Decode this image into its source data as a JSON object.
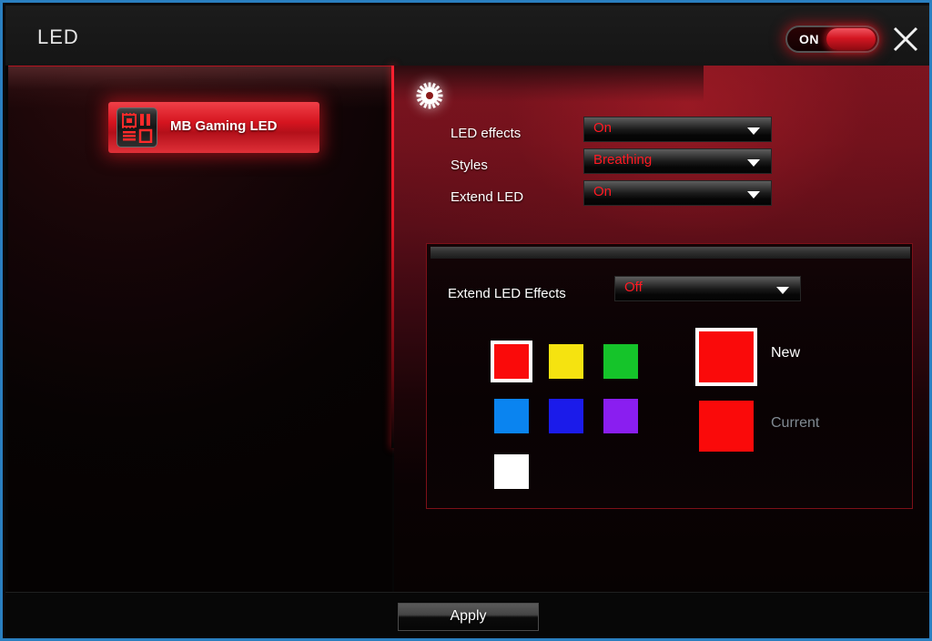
{
  "window": {
    "title": "LED",
    "accent_color": "#d5141f",
    "frame_color": "#2a7fc0",
    "power_toggle": {
      "state_label": "ON",
      "enabled": true
    },
    "close_label": "Close"
  },
  "sidebar": {
    "items": [
      {
        "label": "MB Gaming LED",
        "icon": "motherboard-icon",
        "selected": true
      }
    ]
  },
  "main": {
    "header_icon": "gear-icon",
    "settings": [
      {
        "label": "LED effects",
        "value": "On"
      },
      {
        "label": "Styles",
        "value": "Breathing"
      },
      {
        "label": "Extend LED",
        "value": "On"
      }
    ],
    "extend_section": {
      "label": "Extend LED Effects",
      "value": "Off",
      "swatches": [
        {
          "name": "red",
          "color": "#fa0a0a",
          "selected": true
        },
        {
          "name": "yellow",
          "color": "#f5e310",
          "selected": false
        },
        {
          "name": "green",
          "color": "#15c42a",
          "selected": false
        },
        {
          "name": "light-blue",
          "color": "#0a84f0",
          "selected": false
        },
        {
          "name": "blue",
          "color": "#1b1bea",
          "selected": false
        },
        {
          "name": "purple",
          "color": "#8a1ef0",
          "selected": false
        },
        {
          "name": "white",
          "color": "#ffffff",
          "selected": false
        }
      ],
      "preview": {
        "new": {
          "label": "New",
          "color": "#fa0a0a",
          "text_color": "#ffffff"
        },
        "current": {
          "label": "Current",
          "color": "#fa0a0a",
          "text_color": "#808a92"
        }
      }
    }
  },
  "footer": {
    "apply_label": "Apply"
  }
}
